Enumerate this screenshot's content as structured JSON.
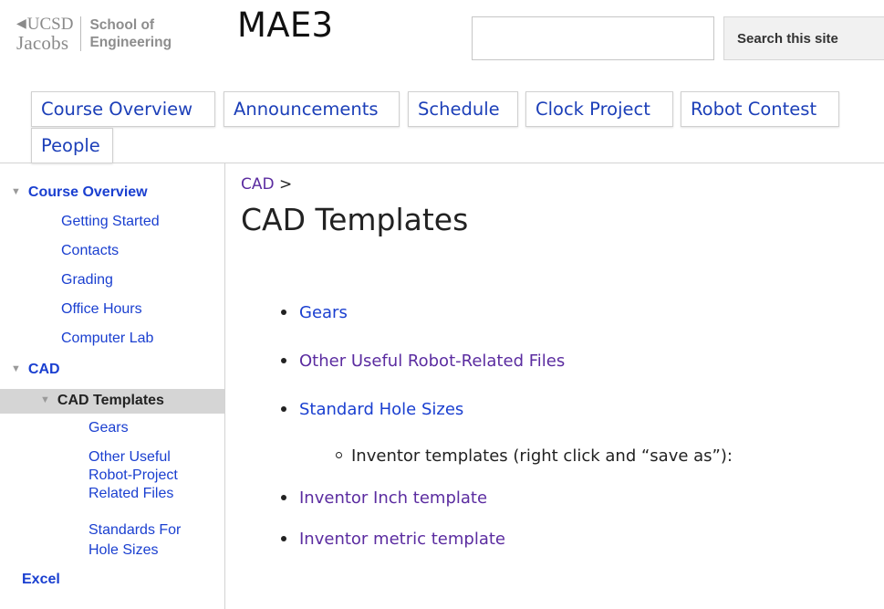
{
  "header": {
    "logo": {
      "ucsd": "UCSD",
      "jacobs": "Jacobs",
      "school_line1": "School of",
      "school_line2": "Engineering"
    },
    "site_title": "MAE3",
    "search": {
      "value": "",
      "button_label": "Search this site"
    }
  },
  "tabs": [
    {
      "label": "Course Overview"
    },
    {
      "label": "Announcements"
    },
    {
      "label": "Schedule"
    },
    {
      "label": "Clock Project"
    },
    {
      "label": "Robot Contest"
    },
    {
      "label": "People"
    }
  ],
  "sidebar": {
    "items": [
      {
        "label": "Course Overview",
        "expanded": true
      },
      {
        "label": "Getting Started"
      },
      {
        "label": "Contacts"
      },
      {
        "label": "Grading"
      },
      {
        "label": "Office Hours"
      },
      {
        "label": "Computer Lab"
      },
      {
        "label": "CAD",
        "expanded": true
      },
      {
        "label": "CAD Templates",
        "expanded": true,
        "selected": true
      },
      {
        "label": "Gears"
      },
      {
        "label": "Other Useful"
      },
      {
        "label": "Robot-Project"
      },
      {
        "label": "Related Files"
      },
      {
        "label": "Standards For"
      },
      {
        "label": "Hole Sizes"
      },
      {
        "label": "Excel"
      }
    ]
  },
  "main": {
    "breadcrumb": {
      "parent": "CAD",
      "separator": ">"
    },
    "title": "CAD Templates",
    "list": [
      {
        "label": "Gears"
      },
      {
        "label": "Other Useful Robot-Related Files"
      },
      {
        "label": "Standard Hole Sizes"
      },
      {
        "label": "Inventor templates (right click and “save as”):"
      },
      {
        "label": "Inventor Inch template"
      },
      {
        "label": "Inventor metric template"
      }
    ]
  },
  "colors": {
    "link": "#1a3fd0",
    "visited_link": "#5b2ca0",
    "selected_bg": "#d5d5d5"
  }
}
